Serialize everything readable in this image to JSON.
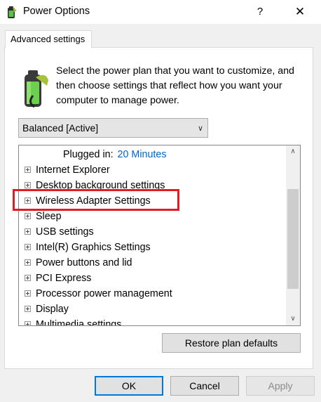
{
  "window": {
    "title": "Power Options",
    "help": "?",
    "close": "✕"
  },
  "tab": {
    "label": "Advanced settings"
  },
  "description": "Select the power plan that you want to customize, and then choose settings that reflect how you want your computer to manage power.",
  "plan_select": {
    "value": "Balanced [Active]"
  },
  "tree": {
    "subrow": {
      "label": "Plugged in:",
      "value": "20 Minutes"
    },
    "items": [
      "Internet Explorer",
      "Desktop background settings",
      "Wireless Adapter Settings",
      "Sleep",
      "USB settings",
      "Intel(R) Graphics Settings",
      "Power buttons and lid",
      "PCI Express",
      "Processor power management",
      "Display",
      "Multimedia settings"
    ]
  },
  "buttons": {
    "restore": "Restore plan defaults",
    "ok": "OK",
    "cancel": "Cancel",
    "apply": "Apply"
  },
  "colors": {
    "accent": "#0078d7",
    "highlight": "#e31b23",
    "link": "#0066cc"
  }
}
